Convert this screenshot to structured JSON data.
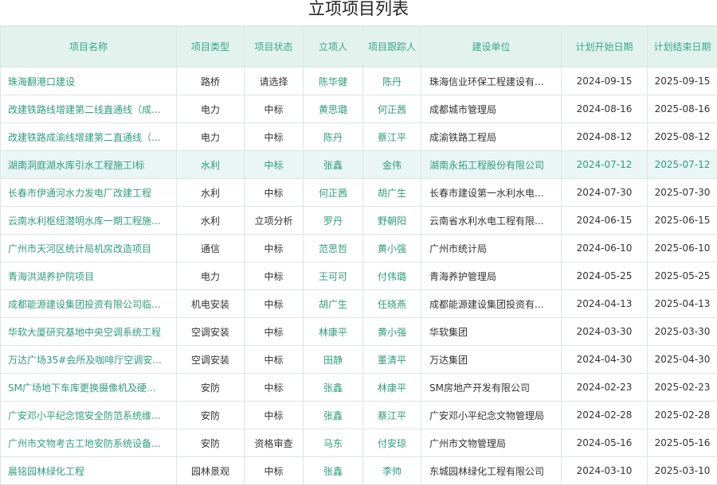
{
  "page_title": "立项项目列表",
  "columns": [
    "项目名称",
    "项目类型",
    "项目状态",
    "立项人",
    "项目跟踪人",
    "建设单位",
    "计划开始日期",
    "计划结束日期"
  ],
  "rows": [
    [
      "珠海翻港口建设",
      "路桥",
      "请选择",
      "陈华健",
      "陈丹",
      "珠海信业环保工程建设有...",
      "2024-09-15",
      "2025-09-15"
    ],
    [
      "改建铁路线增建第二线直通线（成...",
      "电力",
      "中标",
      "黄思璐",
      "何正茜",
      "成都城市管理局",
      "2024-08-16",
      "2025-08-16"
    ],
    [
      "改建铁路成渝线增建第二直通线（...",
      "电力",
      "中标",
      "陈丹",
      "蔡江平",
      "成渝铁路工程局",
      "2024-08-12",
      "2025-08-12"
    ],
    [
      "湖南洞庭湖水库引水工程施工Ⅰ标",
      "水利",
      "中标",
      "张鑫",
      "金伟",
      "湖南永拓工程股份有限公司",
      "2024-07-12",
      "2025-07-12"
    ],
    [
      "长春市伊通河水力发电厂改建工程",
      "水利",
      "中标",
      "何正茜",
      "胡广生",
      "长春市建设第一水利水电...",
      "2024-07-30",
      "2025-07-30"
    ],
    [
      "云南水利枢纽潜明水库一期工程施...",
      "水利",
      "立项分析",
      "罗丹",
      "野朝阳",
      "云南省水利水电工程有限...",
      "2024-06-15",
      "2025-06-15"
    ],
    [
      "广州市天河区统计局机房改造项目",
      "通信",
      "中标",
      "范思哲",
      "黄小强",
      "广州市统计局",
      "2024-06-10",
      "2025-06-10"
    ],
    [
      "青海洪湖养护院项目",
      "电力",
      "中标",
      "王可可",
      "付伟璐",
      "青海养护管理局",
      "2024-05-25",
      "2025-05-25"
    ],
    [
      "成都能源建设集团投资有限公司临...",
      "机电安装",
      "中标",
      "胡广生",
      "任晓燕",
      "成都能源建设集团投资有...",
      "2024-04-13",
      "2025-04-13"
    ],
    [
      "华软大厦研究基地中央空调系统工程",
      "空调安装",
      "中标",
      "林康平",
      "黄小强",
      "华软集团",
      "2024-03-30",
      "2025-03-30"
    ],
    [
      "万达广场35#会所及咖啡厅空调安...",
      "空调安装",
      "中标",
      "田静",
      "董清平",
      "万达集团",
      "2024-04-30",
      "2025-04-30"
    ],
    [
      "SM广场地下车库更换摄像机及硬...",
      "安防",
      "中标",
      "张鑫",
      "林康平",
      "SM房地产开发有限公司",
      "2024-02-23",
      "2025-02-23"
    ],
    [
      "广安邓小平纪念馆安全防范系统维...",
      "安防",
      "中标",
      "张鑫",
      "蔡江平",
      "广安邓小平纪念文物管理局",
      "2024-02-28",
      "2025-02-28"
    ],
    [
      "广州市文物考古工地安防系统设备...",
      "安防",
      "资格审查",
      "马东",
      "付安琼",
      "广州市文物管理局",
      "2024-05-16",
      "2025-05-16"
    ],
    [
      "晨铭园林绿化工程",
      "园林景观",
      "中标",
      "张鑫",
      "李帅",
      "东城园林绿化工程有限公司",
      "2024-03-10",
      "2025-03-10"
    ]
  ],
  "highlight_row_index": 3
}
